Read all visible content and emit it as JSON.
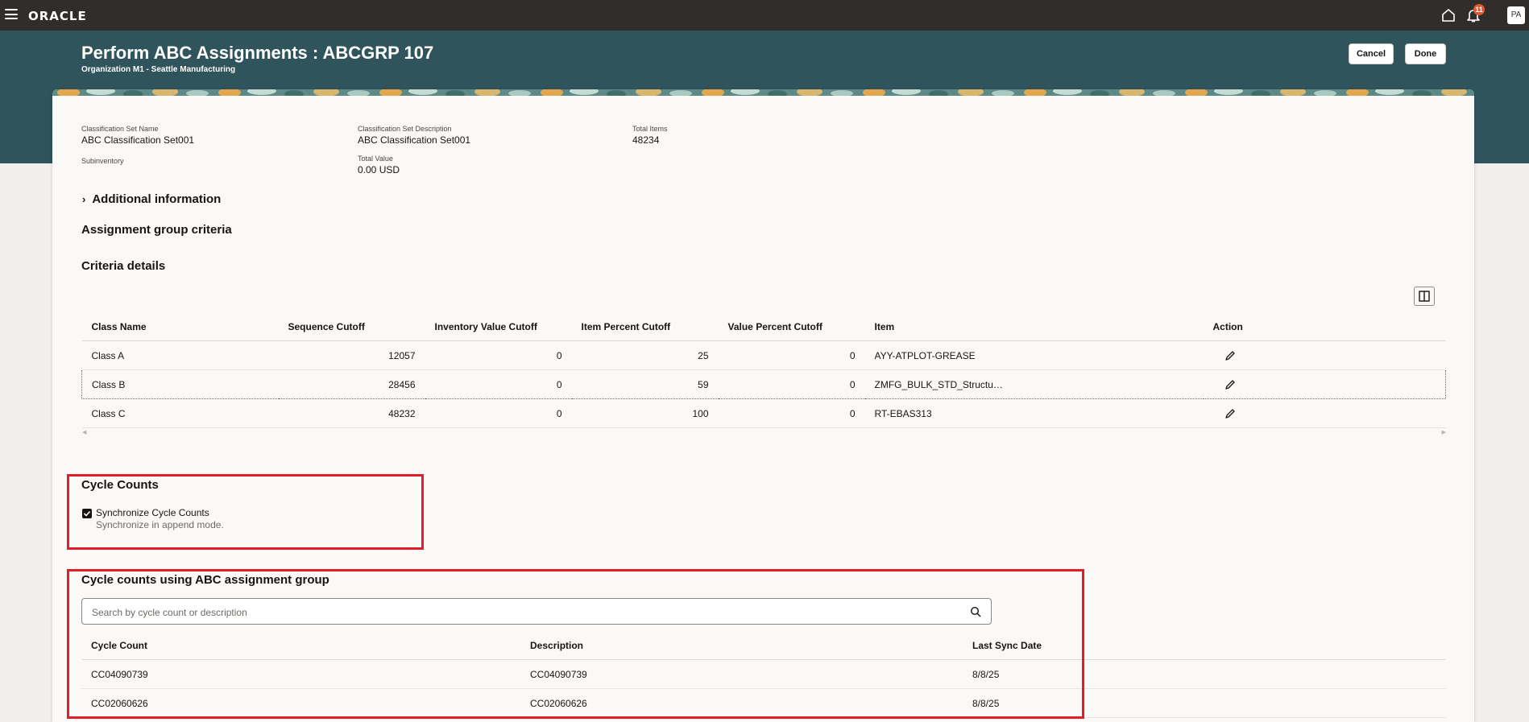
{
  "app": {
    "logo": "ORACLE",
    "notification_count": "11",
    "user_initials": "PA"
  },
  "header": {
    "title": "Perform ABC Assignments : ABCGRP 107",
    "subtitle": "Organization M1 - Seattle Manufacturing",
    "cancel_label": "Cancel",
    "done_label": "Done"
  },
  "summary": {
    "set_name_label": "Classification Set Name",
    "set_name_value": "ABC Classification Set001",
    "set_desc_label": "Classification Set Description",
    "set_desc_value": "ABC Classification Set001",
    "total_items_label": "Total Items",
    "total_items_value": "48234",
    "subinventory_label": "Subinventory",
    "total_value_label": "Total Value",
    "total_value_value": "0.00 USD"
  },
  "sections": {
    "additional_info": "Additional information",
    "assignment_criteria": "Assignment group criteria",
    "criteria_details": "Criteria details",
    "cycle_counts": "Cycle Counts",
    "cycle_counts_group": "Cycle counts using ABC assignment group"
  },
  "criteria_table": {
    "headers": [
      "Class Name",
      "Sequence Cutoff",
      "Inventory Value Cutoff",
      "Item Percent Cutoff",
      "Value Percent Cutoff",
      "Item",
      "Action"
    ],
    "rows": [
      {
        "class_name": "Class A",
        "sequence_cutoff": "12057",
        "inventory_value_cutoff": "0",
        "item_percent_cutoff": "25",
        "value_percent_cutoff": "0",
        "item": "AYY-ATPLOT-GREASE"
      },
      {
        "class_name": "Class B",
        "sequence_cutoff": "28456",
        "inventory_value_cutoff": "0",
        "item_percent_cutoff": "59",
        "value_percent_cutoff": "0",
        "item": "ZMFG_BULK_STD_Structu…"
      },
      {
        "class_name": "Class C",
        "sequence_cutoff": "48232",
        "inventory_value_cutoff": "0",
        "item_percent_cutoff": "100",
        "value_percent_cutoff": "0",
        "item": "RT-EBAS313"
      }
    ]
  },
  "cycle_counts": {
    "synchronize_label": "Synchronize Cycle Counts",
    "synchronize_help": "Synchronize in append mode.",
    "synchronize_checked": true
  },
  "cycle_search": {
    "placeholder": "Search by cycle count or description",
    "value": ""
  },
  "cycle_table": {
    "headers": [
      "Cycle Count",
      "Description",
      "Last Sync Date"
    ],
    "rows": [
      {
        "cycle_count": "CC04090739",
        "description": "CC04090739",
        "last_sync_date": "8/8/25"
      },
      {
        "cycle_count": "CC02060626",
        "description": "CC02060626",
        "last_sync_date": "8/8/25"
      }
    ]
  },
  "colors": {
    "topbar": "#312d2a",
    "header_band": "#2f545c",
    "highlight_box": "#e21d2a",
    "badge": "#e4572e"
  },
  "icons": [
    "menu-icon",
    "home-icon",
    "bell-icon",
    "chevron-right-icon",
    "column-view-icon",
    "pencil-icon",
    "search-icon",
    "checkmark-icon"
  ]
}
